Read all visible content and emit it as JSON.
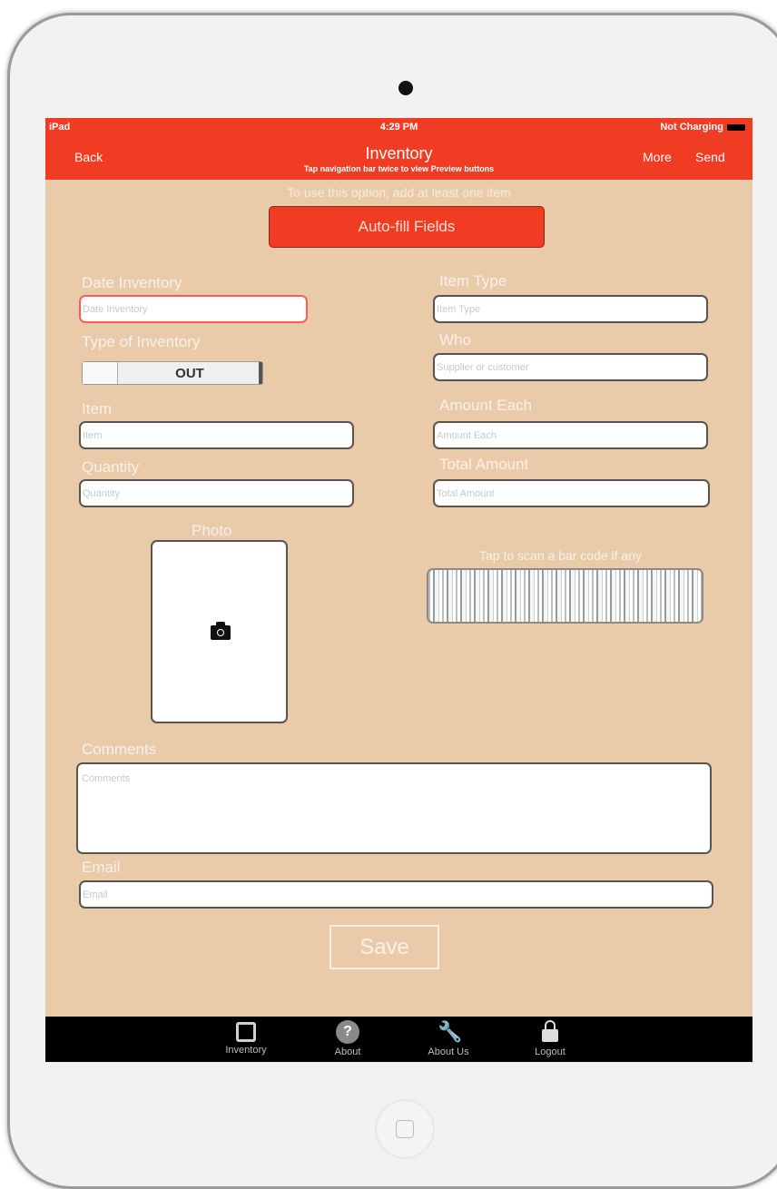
{
  "status_bar": {
    "device": "iPad",
    "time": "4:29 PM",
    "battery": "Not Charging"
  },
  "nav": {
    "back": "Back",
    "title": "Inventory",
    "subtitle": "Tap navigation bar twice to view Preview buttons",
    "more": "More",
    "send": "Send"
  },
  "autofill": {
    "hint": "To use this option, add at least one item",
    "button": "Auto-fill Fields"
  },
  "form": {
    "date_inventory": {
      "label": "Date Inventory",
      "placeholder": "Date Inventory"
    },
    "type_of_inventory": {
      "label": "Type of Inventory",
      "value": "OUT"
    },
    "item": {
      "label": "Item",
      "placeholder": "Item"
    },
    "quantity": {
      "label": "Quantity",
      "placeholder": "Quantity"
    },
    "item_type": {
      "label": "Item Type",
      "placeholder": "Item Type"
    },
    "who": {
      "label": "Who",
      "placeholder": "Supplier or customer"
    },
    "amount_each": {
      "label": "Amount Each",
      "placeholder": "Amount Each"
    },
    "total_amount": {
      "label": "Total Amount",
      "placeholder": "Total Amount"
    },
    "photo": {
      "label": "Photo"
    },
    "barcode": {
      "label": "Tap to scan a bar code if any"
    },
    "comments": {
      "label": "Comments",
      "placeholder": "Comments"
    },
    "email": {
      "label": "Email",
      "placeholder": "Email"
    },
    "save": "Save"
  },
  "tabs": [
    {
      "label": "Inventory",
      "icon": "edit-icon"
    },
    {
      "label": "About",
      "icon": "help-icon"
    },
    {
      "label": "About Us",
      "icon": "wrench-icon"
    },
    {
      "label": "Logout",
      "icon": "lock-icon"
    }
  ],
  "colors": {
    "accent": "#f13c24",
    "background": "#e9cbaa",
    "tabbar": "#000000"
  }
}
